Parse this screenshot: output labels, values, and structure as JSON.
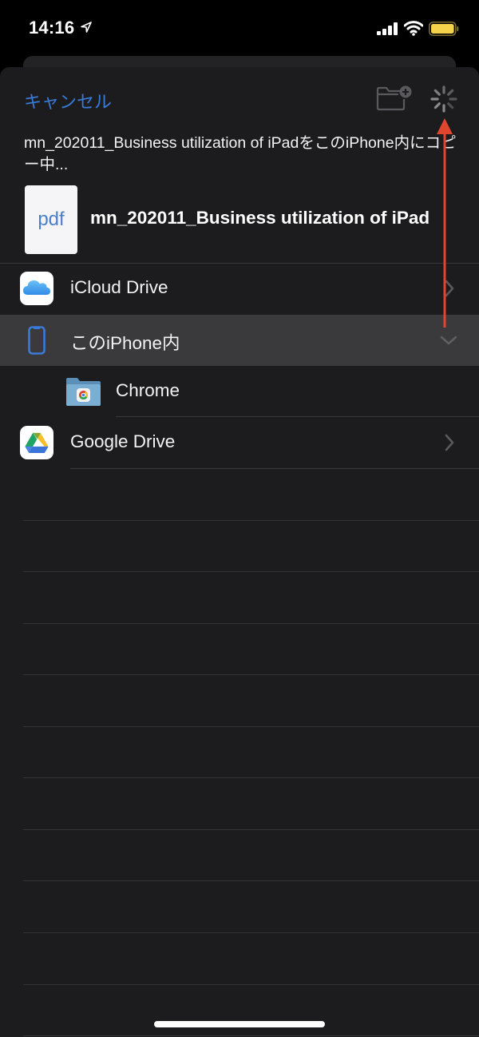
{
  "status_bar": {
    "time": "14:16",
    "location_icon": "location-arrow-icon",
    "signal_icon": "cellular-signal-icon",
    "wifi_icon": "wifi-icon",
    "battery_icon": "battery-icon",
    "battery_color": "#f5d24b"
  },
  "header": {
    "cancel_label": "キャンセル",
    "cancel_color": "#3a7ad8",
    "new_folder_icon": "new-folder-icon",
    "activity_icon": "activity-spinner-icon"
  },
  "copy_status": {
    "message": "mn_202011_Business utilization of iPadをこのiPhone内にコピー中..."
  },
  "file": {
    "thumbnail_label": "pdf",
    "name": "mn_202011_Business utilization of iPad"
  },
  "locations": [
    {
      "label": "iCloud Drive",
      "icon": "icloud-drive-icon",
      "accessory": "chevron-right-icon",
      "selected": false
    },
    {
      "label": "このiPhone内",
      "icon": "iphone-icon",
      "accessory": "chevron-down-icon",
      "selected": true
    },
    {
      "label": "Chrome",
      "icon": "chrome-folder-icon",
      "accessory": "",
      "selected": false,
      "indent": true
    },
    {
      "label": "Google Drive",
      "icon": "google-drive-icon",
      "accessory": "chevron-right-icon",
      "selected": false
    }
  ],
  "annotation": {
    "arrow_color": "#e0452e",
    "arrow_direction": "up"
  }
}
